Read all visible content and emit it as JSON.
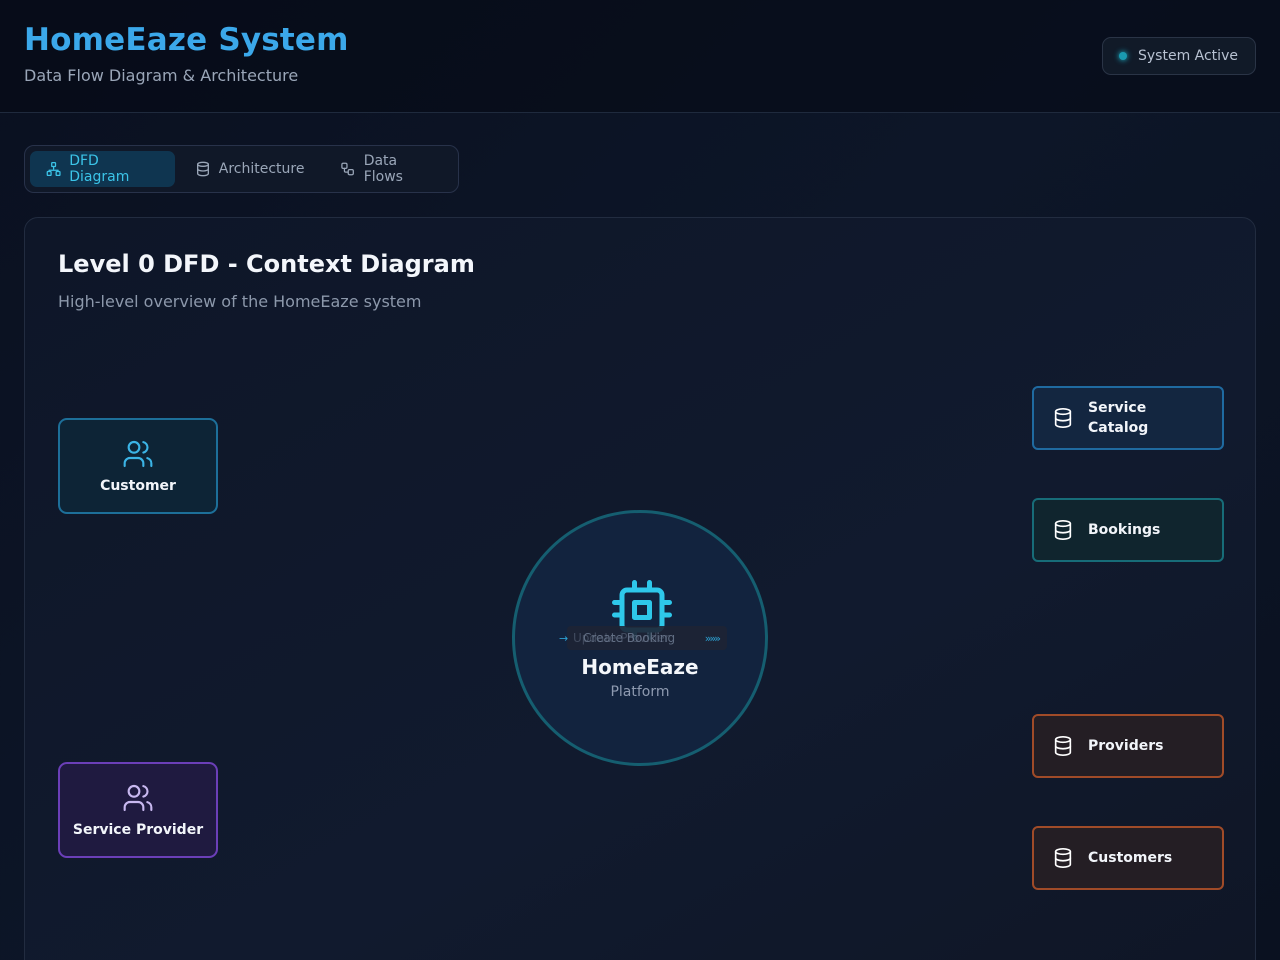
{
  "header": {
    "title": "HomeEaze System",
    "subtitle": "Data Flow Diagram & Architecture",
    "status": "System Active"
  },
  "tabs": [
    {
      "label": "DFD Diagram",
      "icon": "sitemap-icon",
      "active": true
    },
    {
      "label": "Architecture",
      "icon": "database-icon",
      "active": false
    },
    {
      "label": "Data Flows",
      "icon": "workflow-icon",
      "active": false
    }
  ],
  "diagram": {
    "title": "Level 0 DFD - Context Diagram",
    "subtitle": "High-level overview of the HomeEaze system",
    "entities": [
      {
        "label": "Customer",
        "icon": "users-icon",
        "color": "#1d6f99"
      },
      {
        "label": "Service Provider",
        "icon": "users-icon",
        "color": "#6b3fb8"
      }
    ],
    "process": {
      "title": "HomeEaze",
      "subtitle": "Platform",
      "icon": "cpu-icon"
    },
    "flow_label": "Create Booking",
    "flow_label_overlap": "Update Provider",
    "data_stores": [
      {
        "label": "Service Catalog",
        "icon": "database-icon",
        "color": "#1f6aa0"
      },
      {
        "label": "Bookings",
        "icon": "database-icon",
        "color": "#176c78"
      },
      {
        "label": "Providers",
        "icon": "database-icon",
        "color": "#a04b28"
      },
      {
        "label": "Customers",
        "icon": "database-icon",
        "color": "#a04b28"
      }
    ]
  },
  "colors": {
    "accent": "#3ba8ea",
    "status_dot": "#1a9ab0"
  }
}
